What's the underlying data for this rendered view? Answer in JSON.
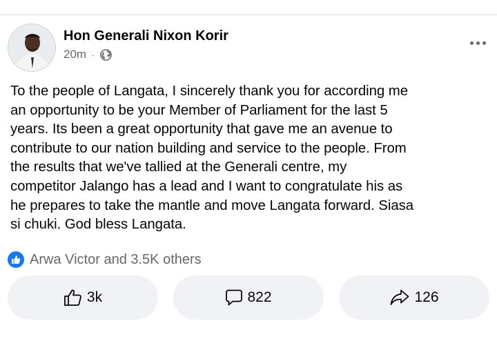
{
  "post": {
    "author": "Hon Generali Nixon Korir",
    "time": "20m",
    "separator": "·",
    "privacy_icon": "globe-icon",
    "lines": [
      "To the people of Langata, I  sincerely thank you for according me",
      "an opportunity to be your Member of Parliament for the last 5",
      "years. Its been a great opportunity that gave me an avenue to",
      "contribute to our nation building and service to the people. From",
      "the results that we've tallied at the Generali centre, my",
      "competitor Jalango has a lead and I want to congratulate his as",
      "he prepares to take the mantle and move Langata forward. Siasa",
      "si chuki. God bless Langata."
    ]
  },
  "reactions": {
    "icon": "like-icon",
    "text": "Arwa Victor and 3.5K others"
  },
  "actions": {
    "like_count": "3k",
    "comment_count": "822",
    "share_count": "126"
  },
  "colors": {
    "accent": "#1877f2",
    "muted_text": "#65676b",
    "button_bg": "#f0f2f5"
  }
}
